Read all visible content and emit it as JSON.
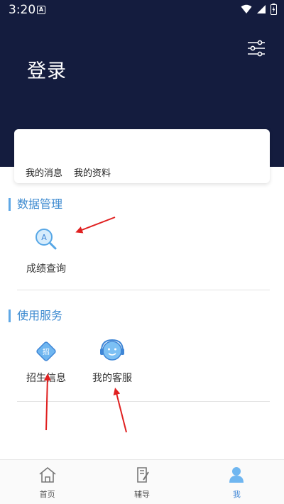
{
  "status_bar": {
    "time": "3:20",
    "notification_letter": "A"
  },
  "header": {
    "login_label": "登录"
  },
  "card": {
    "messages": "我的消息",
    "profile": "我的资料"
  },
  "sections": {
    "data_management": {
      "title": "数据管理",
      "items": [
        {
          "label": "成绩查询",
          "icon": "grade-search-icon",
          "icon_letter": "A"
        }
      ]
    },
    "services": {
      "title": "使用服务",
      "items": [
        {
          "label": "招生信息",
          "icon": "admissions-icon",
          "icon_letter": "招"
        },
        {
          "label": "我的客服",
          "icon": "customer-service-icon"
        }
      ]
    }
  },
  "tabbar": {
    "tabs": [
      {
        "label": "首页",
        "icon": "home-icon",
        "active": false
      },
      {
        "label": "辅导",
        "icon": "tutoring-icon",
        "active": false
      },
      {
        "label": "我",
        "icon": "user-icon",
        "active": true
      }
    ]
  },
  "colors": {
    "header_bg": "#141c3e",
    "accent": "#3f86d6",
    "annotation_arrow": "#e02020"
  }
}
